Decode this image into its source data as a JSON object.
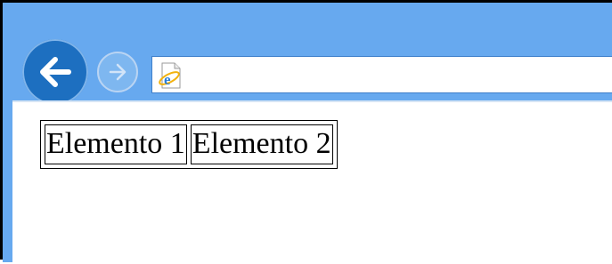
{
  "browser": {
    "back_button_icon": "arrow-left-icon",
    "forward_button_icon": "arrow-right-icon",
    "page_icon": "internet-explorer-page-icon",
    "address_value": "",
    "accent_color": "#67a9ef",
    "back_button_color": "#1d6fc0"
  },
  "content": {
    "table": {
      "rows": [
        [
          "Elemento 1",
          "Elemento 2"
        ]
      ]
    }
  }
}
